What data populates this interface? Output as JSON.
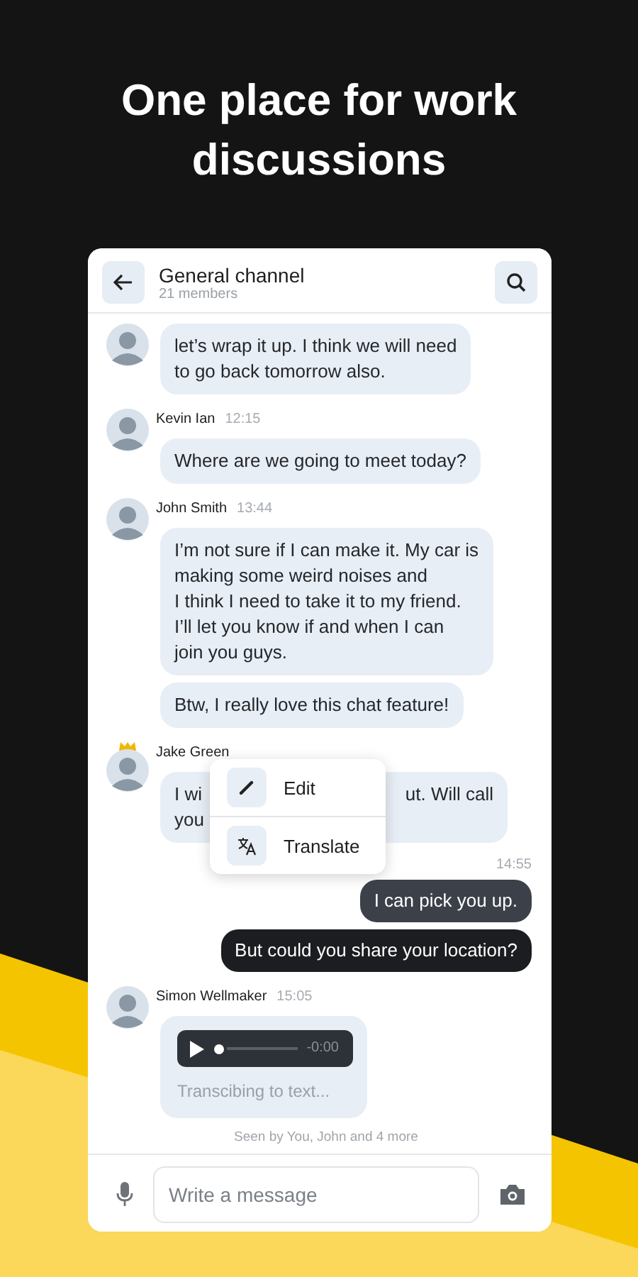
{
  "headline": "One place for work discussions",
  "header": {
    "title": "General channel",
    "subtitle": "21 members"
  },
  "messages": [
    {
      "kind": "incoming",
      "bubbles": [
        "let’s wrap it up. I think we will need\nto go back tomorrow also."
      ]
    },
    {
      "kind": "incoming",
      "author": "Kevin Ian",
      "time": "12:15",
      "bubbles": [
        "Where are we going to meet today?"
      ]
    },
    {
      "kind": "incoming",
      "author": "John Smith",
      "time": "13:44",
      "bubbles": [
        "I’m not sure if I can make it. My car is\nmaking some weird noises and\nI think I need to take it to my friend.\nI’ll let you know if and when I can\njoin you guys.",
        "Btw, I really love this chat feature!"
      ]
    },
    {
      "kind": "covered",
      "crowned": true,
      "author": "Jake Green",
      "lines": [
        [
          "I wi",
          "ut. Will call"
        ],
        [
          "you"
        ]
      ]
    },
    {
      "kind": "outgoing",
      "time": "14:55",
      "bubbles": [
        {
          "text": "I can pick you up.",
          "color": "#3b4049"
        },
        {
          "text": "But could you share your location?",
          "color": "#1c1d20"
        }
      ]
    },
    {
      "kind": "voice",
      "author": "Simon Wellmaker",
      "time": "15:05",
      "duration": "-0:00",
      "caption": "Transcibing to text...",
      "seen": "Seen by You, John and 4 more"
    }
  ],
  "menu": [
    {
      "kind": "edit",
      "label": "Edit"
    },
    {
      "kind": "translate",
      "label": "Translate"
    }
  ],
  "composer": {
    "placeholder": "Write a message"
  }
}
